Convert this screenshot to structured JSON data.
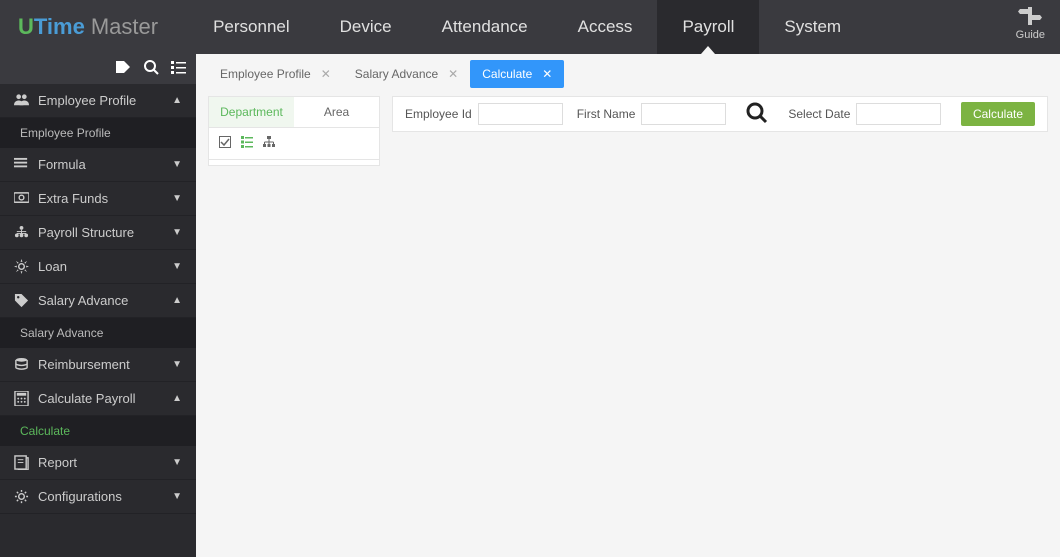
{
  "logo": {
    "part1": "U",
    "part2": "Time",
    "part3": "Master"
  },
  "topnav": [
    {
      "label": "Personnel",
      "active": false
    },
    {
      "label": "Device",
      "active": false
    },
    {
      "label": "Attendance",
      "active": false
    },
    {
      "label": "Access",
      "active": false
    },
    {
      "label": "Payroll",
      "active": true
    },
    {
      "label": "System",
      "active": false
    }
  ],
  "guide_label": "Guide",
  "sidebar": [
    {
      "label": "Employee Profile",
      "icon": "users",
      "expanded": true,
      "sub": [
        {
          "label": "Employee Profile",
          "active": false
        }
      ]
    },
    {
      "label": "Formula",
      "icon": "list",
      "expanded": false
    },
    {
      "label": "Extra Funds",
      "icon": "money",
      "expanded": false
    },
    {
      "label": "Payroll Structure",
      "icon": "structure",
      "expanded": false
    },
    {
      "label": "Loan",
      "icon": "gear",
      "expanded": false
    },
    {
      "label": "Salary Advance",
      "icon": "tag",
      "expanded": true,
      "sub": [
        {
          "label": "Salary Advance",
          "active": false
        }
      ]
    },
    {
      "label": "Reimbursement",
      "icon": "db",
      "expanded": false
    },
    {
      "label": "Calculate Payroll",
      "icon": "calc",
      "expanded": true,
      "sub": [
        {
          "label": "Calculate",
          "active": true
        }
      ]
    },
    {
      "label": "Report",
      "icon": "report",
      "expanded": false
    },
    {
      "label": "Configurations",
      "icon": "cog",
      "expanded": false
    }
  ],
  "tabs": [
    {
      "label": "Employee Profile",
      "active": false
    },
    {
      "label": "Salary Advance",
      "active": false
    },
    {
      "label": "Calculate",
      "active": true
    }
  ],
  "filter_tabs": [
    {
      "label": "Department",
      "active": true
    },
    {
      "label": "Area",
      "active": false
    }
  ],
  "filters": {
    "emp_id_label": "Employee Id",
    "first_name_label": "First Name",
    "select_date_label": "Select Date",
    "calc_button": "Calculate"
  }
}
